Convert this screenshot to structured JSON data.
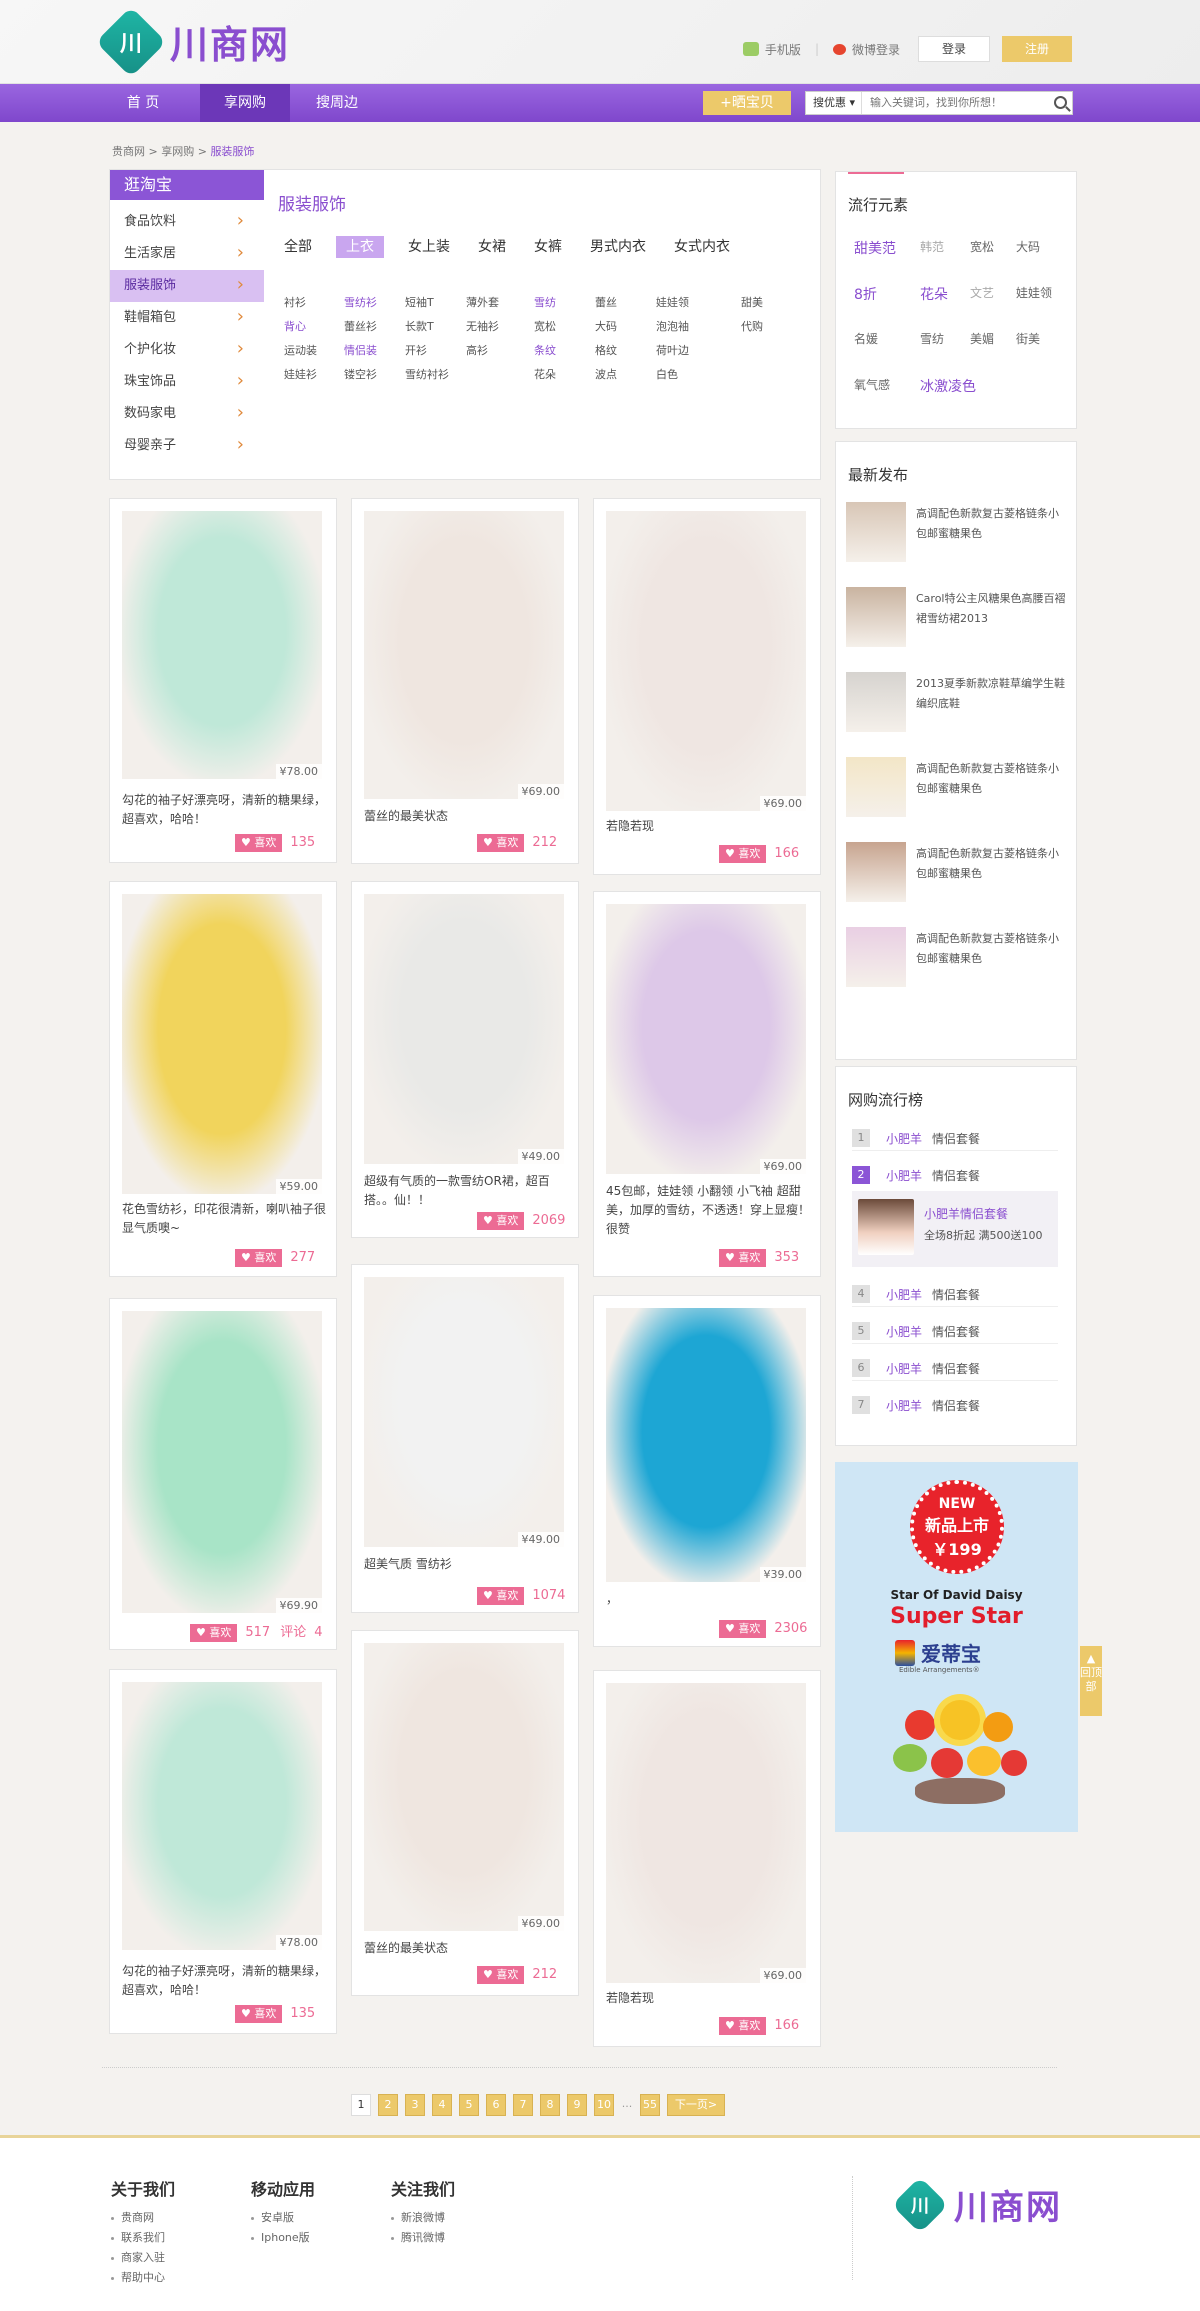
{
  "header": {
    "logo_mark": "川",
    "logo_text": "川商网",
    "mobile_label": "手机版",
    "weibo_login_label": "微博登录",
    "login_label": "登录",
    "register_label": "注册"
  },
  "nav": {
    "items": [
      "首 页",
      "享网购",
      "搜周边"
    ],
    "share_label": "+晒宝贝",
    "search_scope": "搜优惠",
    "search_placeholder": "输入关键词，找到你所想！"
  },
  "breadcrumb": [
    "贵商网",
    "享网购",
    "服装服饰"
  ],
  "sidebar": {
    "title": "逛淘宝",
    "items": [
      "食品饮料",
      "生活家居",
      "服装服饰",
      "鞋帽箱包",
      "个护化妆",
      "珠宝饰品",
      "数码家电",
      "母婴亲子"
    ]
  },
  "category": {
    "title": "服装服饰",
    "tabs": [
      "全部",
      "上衣",
      "女上装",
      "女裙",
      "女裤",
      "男式内衣",
      "女式内衣"
    ],
    "tags": [
      [
        "衬衫",
        "雪纺衫",
        "短袖T",
        "薄外套",
        "雪纺",
        "蕾丝",
        "娃娃领",
        "甜美"
      ],
      [
        "背心",
        "蕾丝衫",
        "长款T",
        "无袖衫",
        "宽松",
        "大码",
        "泡泡袖",
        "代购"
      ],
      [
        "运动装",
        "情侣装",
        "开衫",
        "高衫",
        "条纹",
        "格纹",
        "荷叶边"
      ],
      [
        "娃娃衫",
        "镂空衫",
        "雪纺衬衫",
        "",
        "花朵",
        "波点",
        "白色"
      ]
    ]
  },
  "trends": {
    "title": "流行元素",
    "words": [
      [
        "甜美范",
        "韩范",
        "宽松",
        "大码"
      ],
      [
        "8折",
        "花朵",
        "文艺",
        "娃娃领"
      ],
      [
        "名媛",
        "雪纺",
        "美媚",
        "街美"
      ],
      [
        "氧气感",
        "冰激凌色"
      ]
    ]
  },
  "latest": {
    "title": "最新发布",
    "items": [
      "高调配色新款复古菱格链条小包邮蜜糖果色",
      "Carol特公主风糖果色高腰百褶裙雪纺裙2013",
      "2013夏季新款凉鞋草编学生鞋编织底鞋",
      "高调配色新款复古菱格链条小包邮蜜糖果色",
      "高调配色新款复古菱格链条小包邮蜜糖果色",
      "高调配色新款复古菱格链条小包邮蜜糖果色"
    ]
  },
  "ranking": {
    "title": "网购流行榜",
    "rows": [
      {
        "num": "1",
        "name": "小肥羊",
        "desc": "情侣套餐"
      },
      {
        "num": "2",
        "name": "小肥羊",
        "desc": "情侣套餐"
      },
      {
        "num": "4",
        "name": "小肥羊",
        "desc": "情侣套餐"
      },
      {
        "num": "5",
        "name": "小肥羊",
        "desc": "情侣套餐"
      },
      {
        "num": "6",
        "name": "小肥羊",
        "desc": "情侣套餐"
      },
      {
        "num": "7",
        "name": "小肥羊",
        "desc": "情侣套餐"
      }
    ],
    "featured": {
      "title": "小肥羊情侣套餐",
      "desc": "全场8折起  满500送100"
    }
  },
  "ad": {
    "badge_line1": "NEW",
    "badge_line2": "新品上市",
    "badge_price": "￥199",
    "subtitle": "Star Of David Daisy",
    "title": "Super Star",
    "brand": "爱蒂宝",
    "brand_en": "Edible Arrangements®"
  },
  "products": [
    {
      "price": "¥78.00",
      "desc": "勾花的袖子好漂亮呀，清新的糖果绿，超喜欢，哈哈！",
      "like": "喜欢",
      "count": "135",
      "color": "#bfe8d8"
    },
    {
      "price": "¥69.00",
      "desc": "蕾丝的最美状态",
      "like": "喜欢",
      "count": "212",
      "color": "#efe6e0"
    },
    {
      "price": "¥69.00",
      "desc": "若隐若现",
      "like": "喜欢",
      "count": "166",
      "color": "#efe6e2"
    },
    {
      "price": "¥59.00",
      "desc": "花色雪纺衫，印花很清新，喇叭袖子很显气质噢~",
      "like": "喜欢",
      "count": "277",
      "color": "#f1d45c"
    },
    {
      "price": "¥49.00",
      "desc": "超级有气质的一款雪纺OR裙，超百搭。。仙！！",
      "like": "喜欢",
      "count": "2069",
      "color": "#e9e9e7"
    },
    {
      "price": "¥69.00",
      "desc": "45包邮，娃娃领 小翻领 小飞袖 超甜美，加厚的雪纺，不透透！穿上显瘦！很赞",
      "like": "喜欢",
      "count": "353",
      "color": "#ddc8e8"
    },
    {
      "price": "¥69.90",
      "desc": "",
      "like": "喜欢",
      "count": "517",
      "comment": "评论",
      "comment_count": "4",
      "color": "#a8e4c7"
    },
    {
      "price": "¥49.00",
      "desc": "超美气质 雪纺衫",
      "like": "喜欢",
      "count": "1074",
      "color": "#f2f2f2"
    },
    {
      "price": "¥39.00",
      "desc": "，",
      "like": "喜欢",
      "count": "2306",
      "color": "#1da6d4"
    },
    {
      "price": "¥78.00",
      "desc": "勾花的袖子好漂亮呀，清新的糖果绿，超喜欢，哈哈！",
      "like": "喜欢",
      "count": "135",
      "color": "#bfe8d8"
    },
    {
      "price": "¥69.00",
      "desc": "蕾丝的最美状态",
      "like": "喜欢",
      "count": "212",
      "color": "#efe6e0"
    },
    {
      "price": "¥69.00",
      "desc": "若隐若现",
      "like": "喜欢",
      "count": "166",
      "color": "#efe6e2"
    }
  ],
  "pager": {
    "pages": [
      "1",
      "2",
      "3",
      "4",
      "5",
      "6",
      "7",
      "8",
      "9",
      "10"
    ],
    "dots": "...",
    "last": "55",
    "next": "下一页>"
  },
  "backtop": "回顶部",
  "footer": {
    "cols": [
      {
        "title": "关于我们",
        "links": [
          "贵商网",
          "联系我们",
          "商家入驻",
          "帮助中心"
        ]
      },
      {
        "title": "移动应用",
        "links": [
          "安卓版",
          "Iphone版"
        ]
      },
      {
        "title": "关注我们",
        "links": [
          "新浪微博",
          "腾讯微博"
        ]
      }
    ],
    "logo_text": "川商网"
  }
}
